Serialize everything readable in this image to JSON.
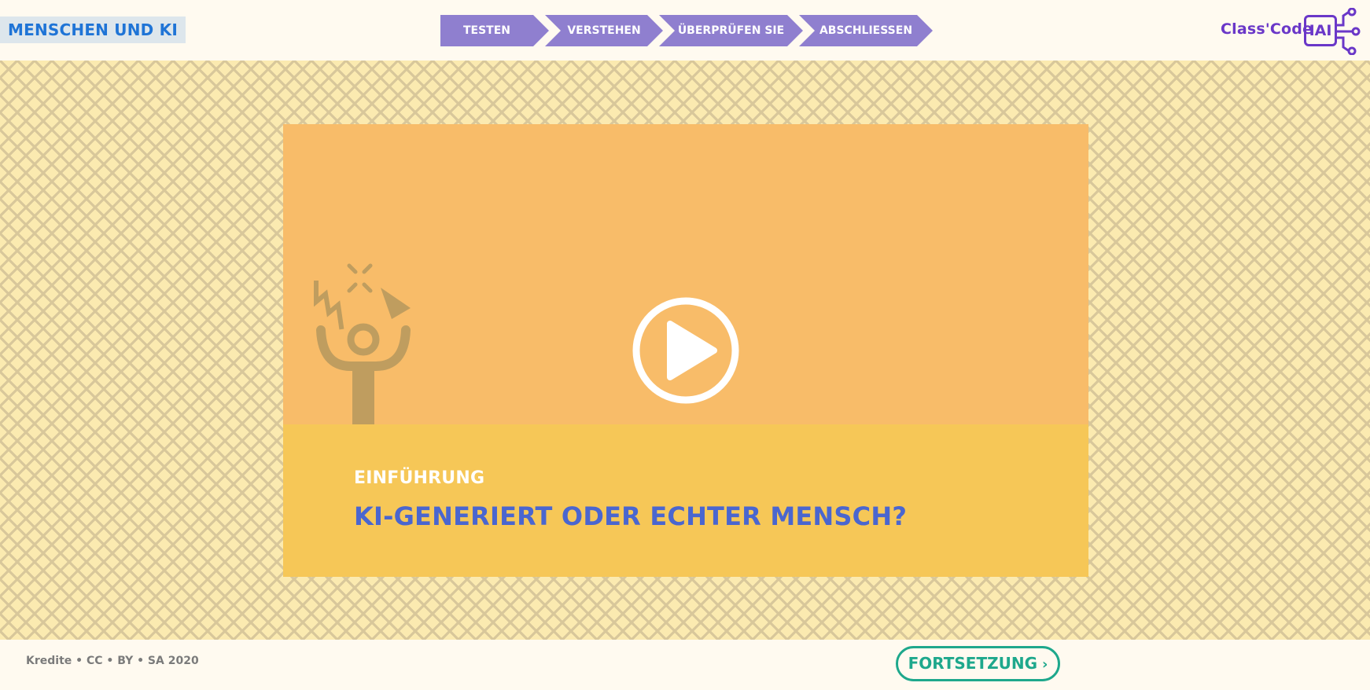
{
  "header": {
    "brand": "MENSCHEN UND KI",
    "steps": [
      {
        "label": "TESTEN"
      },
      {
        "label": "VERSTEHEN"
      },
      {
        "label": "ÜBERPRÜFEN SIE"
      },
      {
        "label": "ABSCHLIESSEN"
      }
    ],
    "logo": {
      "text": "Class'Code",
      "box": "IAI"
    }
  },
  "video": {
    "kicker": "EINFÜHRUNG",
    "title": "KI-GENERIERT ODER ECHTER MENSCH?",
    "play_icon": "play-icon",
    "illustration_icon": "surprised-person-icon"
  },
  "footer": {
    "credits": "Kredite • CC • BY • SA 2020",
    "continue_label": "FORTSETZUNG",
    "continue_icon": "chevron-right-icon"
  },
  "colors": {
    "brand_blue": "#1f74d6",
    "step_purple": "#8f7fcf",
    "logo_purple": "#6a37c8",
    "stage_bg": "#fbeab0",
    "video_bg": "#f8bc69",
    "caption_bg": "#f6c757",
    "title_blue": "#4a66cf",
    "continue_green": "#1ea88c"
  }
}
